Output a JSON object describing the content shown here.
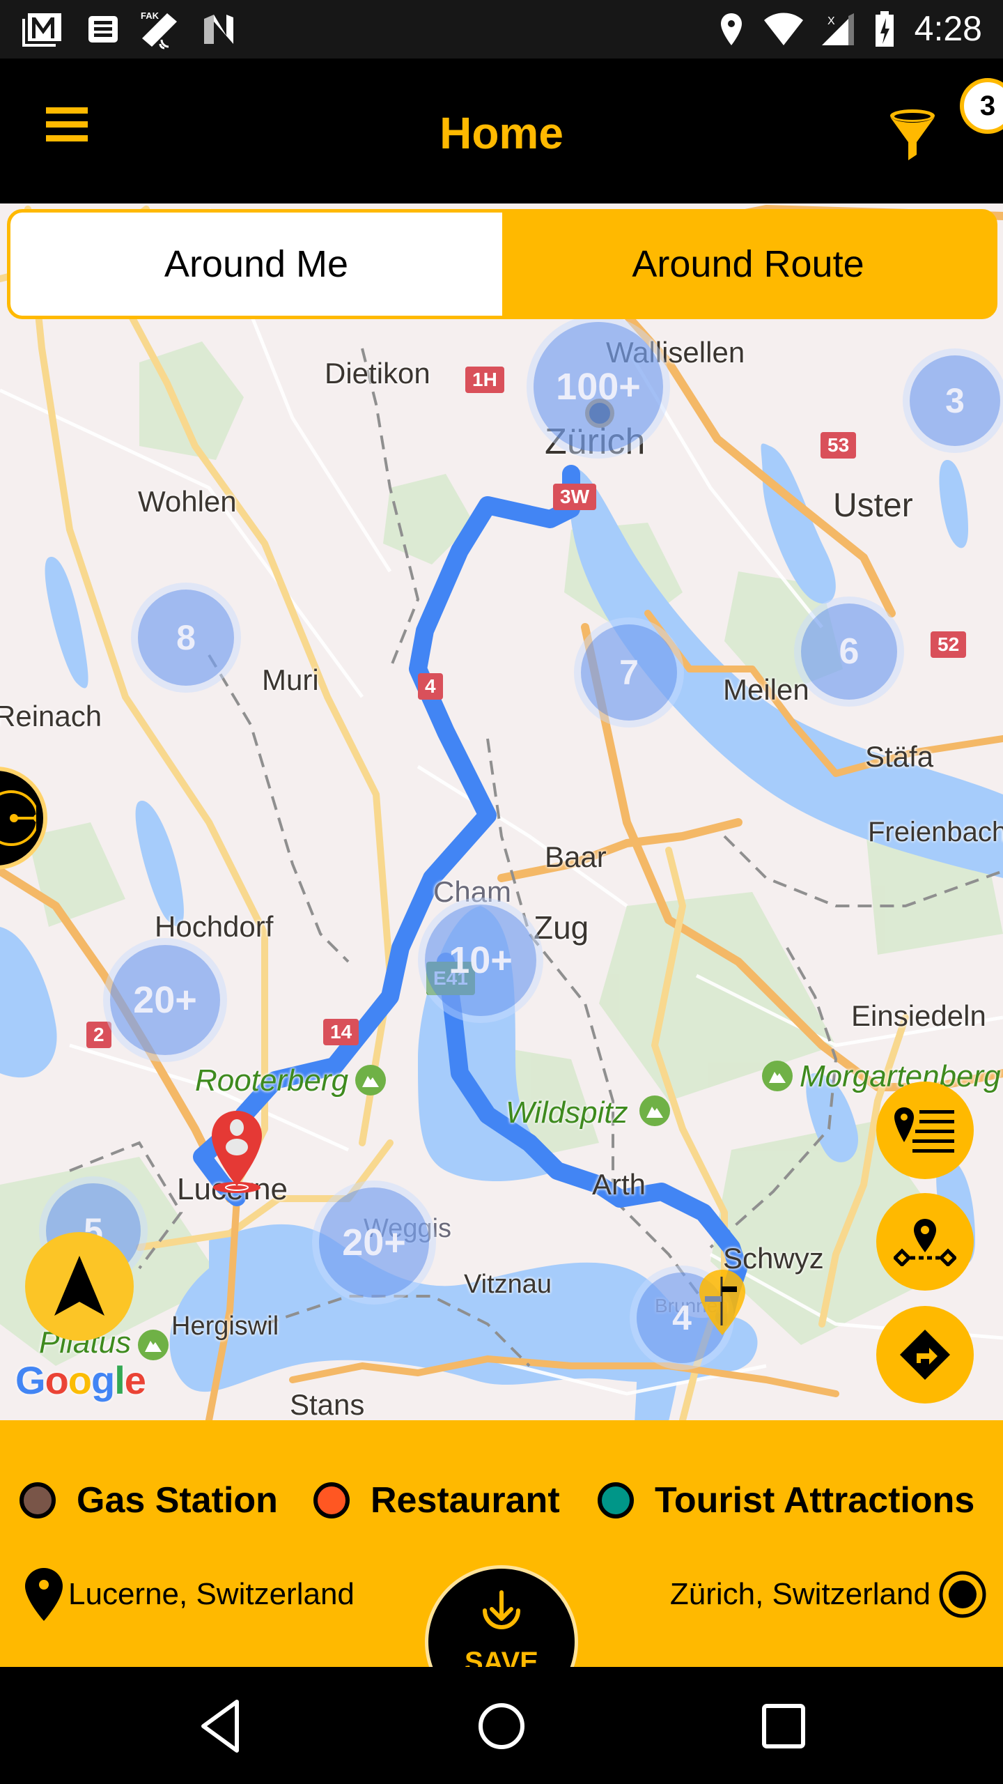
{
  "status_bar": {
    "time": "4:28",
    "left_icons": [
      "gmail-icon",
      "news-icon",
      "fake-gps-icon",
      "n-app-icon"
    ],
    "right_icons": [
      "location-icon",
      "wifi-icon",
      "cell-signal-icon",
      "battery-charging-icon"
    ]
  },
  "app_bar": {
    "title": "Home",
    "menu_icon": "hamburger-menu-icon",
    "filter_icon": "funnel-icon",
    "filter_count": "3"
  },
  "segment": {
    "options": [
      {
        "label": "Around Me",
        "selected": false
      },
      {
        "label": "Around Route",
        "selected": true
      }
    ]
  },
  "map": {
    "places": [
      {
        "name": "Dietikon"
      },
      {
        "name": "Wallisellen"
      },
      {
        "name": "Zürich"
      },
      {
        "name": "Wohlen"
      },
      {
        "name": "Uster"
      },
      {
        "name": "Muri"
      },
      {
        "name": "Meilen"
      },
      {
        "name": "Reinach"
      },
      {
        "name": "Stäfa"
      },
      {
        "name": "Freienbach"
      },
      {
        "name": "Baar"
      },
      {
        "name": "Cham"
      },
      {
        "name": "Zug"
      },
      {
        "name": "Hochdorf"
      },
      {
        "name": "Einsiedeln"
      },
      {
        "name": "Lucerne"
      },
      {
        "name": "Arth"
      },
      {
        "name": "Weggis"
      },
      {
        "name": "Vitznau"
      },
      {
        "name": "Schwyz"
      },
      {
        "name": "Hergiswil"
      },
      {
        "name": "Stans"
      },
      {
        "name": "Brunnen"
      }
    ],
    "peaks": [
      {
        "name": "Rooterberg"
      },
      {
        "name": "Morgartenberg"
      },
      {
        "name": "Wildspitz"
      },
      {
        "name": "Pilatus"
      }
    ],
    "road_shields": [
      "1H",
      "53",
      "3W",
      "4",
      "52",
      "2",
      "14",
      "E41"
    ],
    "clusters": [
      {
        "label": "100+"
      },
      {
        "label": "3"
      },
      {
        "label": "8"
      },
      {
        "label": "7"
      },
      {
        "label": "6"
      },
      {
        "label": "10+"
      },
      {
        "label": "20+"
      },
      {
        "label": "20+"
      },
      {
        "label": "5"
      },
      {
        "label": "4"
      }
    ],
    "attribution": "Google",
    "route_color": "#4285F4",
    "buttons": {
      "poi_list": "poi-list-icon",
      "waypoint": "add-waypoint-icon",
      "directions": "directions-icon",
      "my_location": "navigation-arrow-icon",
      "compass": "compass-icon"
    }
  },
  "legend": [
    {
      "label": "Gas Station",
      "color": "#795548"
    },
    {
      "label": "Restaurant",
      "color": "#FF5722"
    },
    {
      "label": "Tourist Attractions",
      "color": "#009688"
    }
  ],
  "route": {
    "origin": "Lucerne, Switzerland",
    "destination": "Zürich, Switzerland"
  },
  "save_button": {
    "label": "SAVE"
  },
  "nav_bar": {
    "back": "back-icon",
    "home": "home-icon",
    "recents": "recents-icon"
  },
  "colors": {
    "accent": "#FFB900",
    "app_bar_bg": "#000000"
  }
}
